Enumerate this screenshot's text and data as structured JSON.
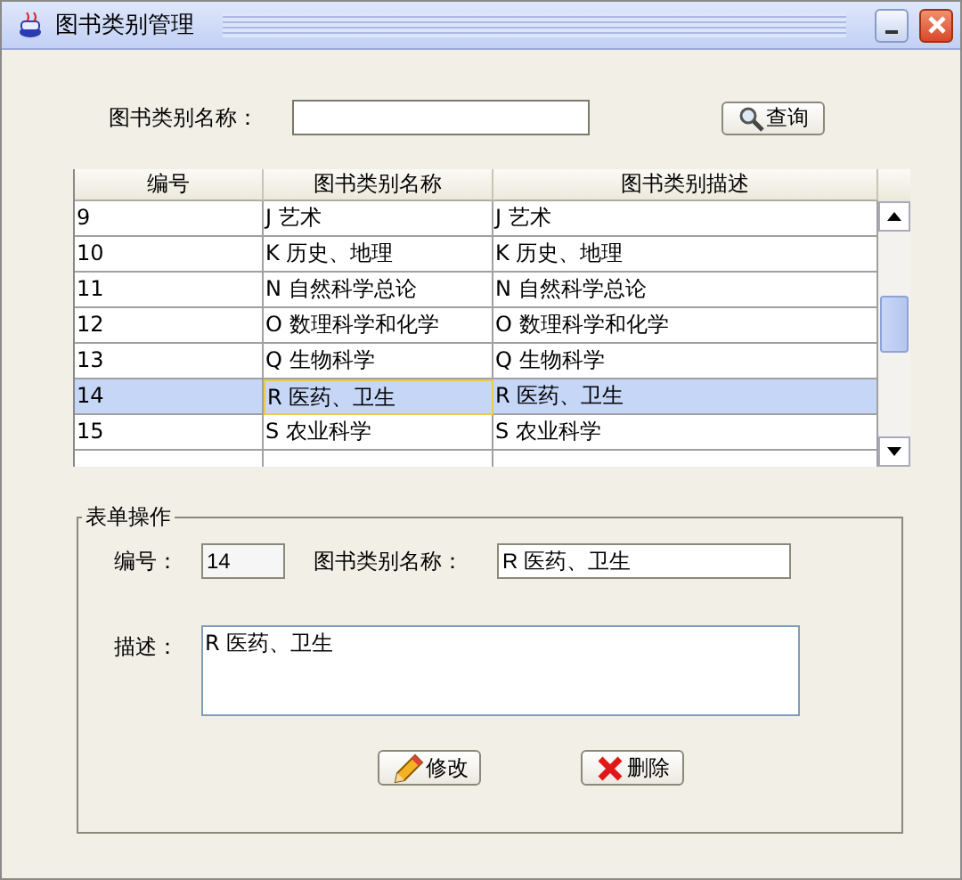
{
  "window": {
    "title": "图书类别管理"
  },
  "search": {
    "label": "图书类别名称：",
    "button": "查询"
  },
  "table": {
    "columns": [
      "编号",
      "图书类别名称",
      "图书类别描述"
    ],
    "rows": [
      {
        "cells": [
          "9",
          "J 艺术",
          "J 艺术"
        ],
        "selected": false
      },
      {
        "cells": [
          "10",
          "K 历史、地理",
          "K 历史、地理"
        ],
        "selected": false
      },
      {
        "cells": [
          "11",
          "N 自然科学总论",
          "N 自然科学总论"
        ],
        "selected": false
      },
      {
        "cells": [
          "12",
          "O 数理科学和化学",
          "O 数理科学和化学"
        ],
        "selected": false
      },
      {
        "cells": [
          "13",
          "Q 生物科学",
          "Q 生物科学"
        ],
        "selected": false
      },
      {
        "cells": [
          "14",
          "R 医药、卫生",
          "R 医药、卫生"
        ],
        "selected": true
      },
      {
        "cells": [
          "15",
          "S 农业科学",
          "S 农业科学"
        ],
        "selected": false
      }
    ]
  },
  "form": {
    "title": "表单操作",
    "id_label": "编号：",
    "id_value": "14",
    "name_label": "图书类别名称：",
    "name_value": "R 医药、卫生",
    "desc_label": "描述：",
    "desc_value": "R 医药、卫生",
    "buttons": [
      {
        "kind": "edit",
        "label": "修改"
      },
      {
        "kind": "delete",
        "label": "删除"
      }
    ]
  }
}
